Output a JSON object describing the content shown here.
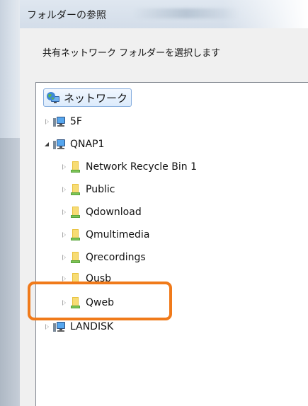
{
  "window": {
    "title": "フォルダーの参照"
  },
  "dialog": {
    "instruction": "共有ネットワーク フォルダーを選択します"
  },
  "tree": {
    "root": {
      "label": "ネットワーク",
      "icon": "network-globe-icon"
    },
    "hosts": [
      {
        "label": "5F",
        "icon": "computer-icon",
        "state": "collapsed"
      },
      {
        "label": "QNAP1",
        "icon": "computer-icon",
        "state": "expanded",
        "folders": [
          {
            "label": "Network Recycle Bin 1",
            "icon": "shared-folder-icon"
          },
          {
            "label": "Public",
            "icon": "shared-folder-icon"
          },
          {
            "label": "Qdownload",
            "icon": "shared-folder-icon"
          },
          {
            "label": "Qmultimedia",
            "icon": "shared-folder-icon"
          },
          {
            "label": "Qrecordings",
            "icon": "shared-folder-icon"
          },
          {
            "label": "Qusb",
            "icon": "shared-folder-icon"
          },
          {
            "label": "Qweb",
            "icon": "shared-folder-icon",
            "highlighted": true
          }
        ]
      },
      {
        "label": "LANDISK",
        "icon": "computer-icon",
        "state": "collapsed"
      }
    ]
  },
  "colors": {
    "highlight": "#f07a1a",
    "selection_border": "#84acdd"
  }
}
